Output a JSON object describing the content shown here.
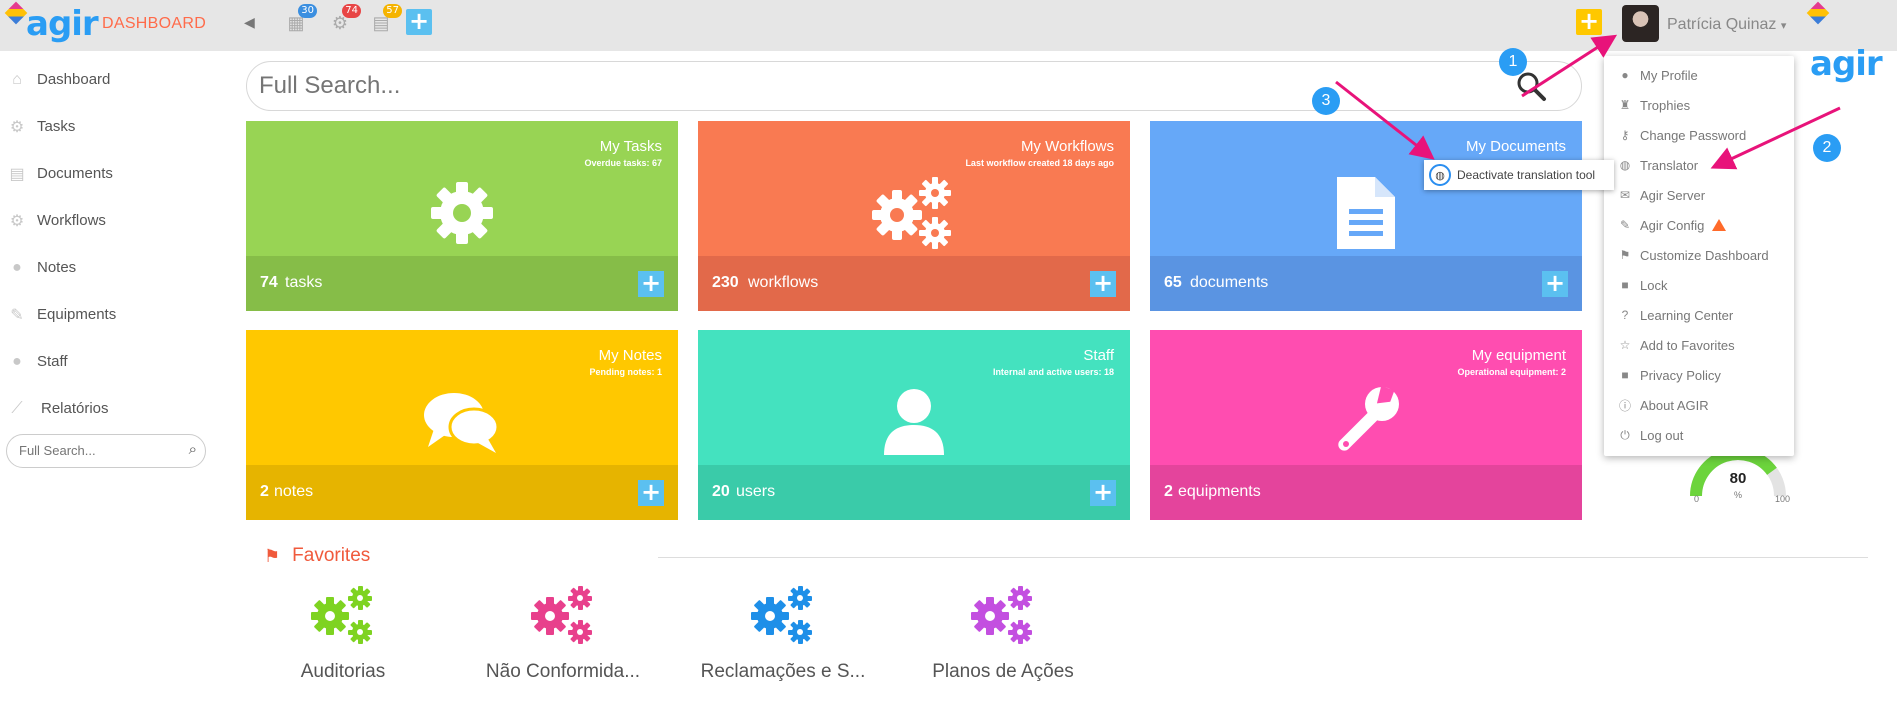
{
  "header": {
    "brand": "agir",
    "section": "DASHBOARD",
    "badges": {
      "calendar": "30",
      "workflows": "74",
      "documents": "57"
    },
    "user_name": "Patrícia Quinaz",
    "colors": {
      "section": "#ff6b4a",
      "badge_blue": "#3b8fe0",
      "badge_red": "#e84545",
      "badge_yellow": "#f5b400"
    }
  },
  "sidebar": {
    "items": [
      {
        "label": "Dashboard",
        "icon": "home-icon"
      },
      {
        "label": "Tasks",
        "icon": "gear-icon"
      },
      {
        "label": "Documents",
        "icon": "document-icon"
      },
      {
        "label": "Workflows",
        "icon": "gears-icon"
      },
      {
        "label": "Notes",
        "icon": "comments-icon"
      },
      {
        "label": "Equipments",
        "icon": "wrench-icon"
      },
      {
        "label": "Staff",
        "icon": "user-icon"
      },
      {
        "label": "Relatórios",
        "icon": "chart-line-icon"
      }
    ],
    "search_placeholder": "Full Search..."
  },
  "main": {
    "search_placeholder": "Full Search...",
    "tiles": [
      {
        "title": "My Tasks",
        "subtitle": "Overdue tasks: 67",
        "count": "74",
        "unit": "tasks",
        "color": "#98d454",
        "foot_color": "#86bd48",
        "icon": "gear-icon"
      },
      {
        "title": "My Workflows",
        "subtitle": "Last workflow created 18 days ago",
        "count": "230",
        "unit": "workflows",
        "color": "#f97a52",
        "foot_color": "#e2694a",
        "icon": "gears-icon"
      },
      {
        "title": "My Documents",
        "subtitle": "",
        "count": "65",
        "unit": "documents",
        "color": "#66a8f8",
        "foot_color": "#5a94e2",
        "icon": "document-icon"
      },
      {
        "title": "My Notes",
        "subtitle": "Pending notes: 1",
        "count": "2",
        "unit": "notes",
        "color": "#ffc800",
        "foot_color": "#e6b400",
        "icon": "comments-icon"
      },
      {
        "title": "Staff",
        "subtitle": "Internal and active users: 18",
        "count": "20",
        "unit": "users",
        "color": "#44e2bf",
        "foot_color": "#3acba9",
        "icon": "user-icon"
      },
      {
        "title": "My equipment",
        "subtitle": "Operational equipment: 2",
        "count": "2",
        "unit": "equipments",
        "color": "#ff4db0",
        "foot_color": "#e4449c",
        "icon": "wrench-icon"
      }
    ]
  },
  "user_menu": {
    "items": [
      {
        "label": "My Profile",
        "icon": "user-icon"
      },
      {
        "label": "Trophies",
        "icon": "trophy-icon"
      },
      {
        "label": "Change Password",
        "icon": "key-icon"
      },
      {
        "label": "Translator",
        "icon": "globe-icon"
      },
      {
        "label": "Agir Server",
        "icon": "envelope-icon"
      },
      {
        "label": "Agir Config",
        "icon": "wrench-icon",
        "warning": true
      },
      {
        "label": "Customize Dashboard",
        "icon": "flag-icon"
      },
      {
        "label": "Lock",
        "icon": "lock-icon"
      },
      {
        "label": "Learning Center",
        "icon": "question-icon"
      },
      {
        "label": "Add to Favorites",
        "icon": "star-icon"
      },
      {
        "label": "Privacy Policy",
        "icon": "lock-icon"
      },
      {
        "label": "About AGIR",
        "icon": "info-icon"
      },
      {
        "label": "Log out",
        "icon": "power-icon"
      }
    ]
  },
  "translator_tooltip": "Deactivate translation tool",
  "annotations": {
    "m1": "1",
    "m2": "2",
    "m3": "3",
    "color": "#e8137a"
  },
  "gauge": {
    "value": "80",
    "unit": "%",
    "min": "0",
    "max": "100",
    "fraction": 0.8,
    "color": "#6cd43c"
  },
  "favorites": {
    "title": "Favorites",
    "items": [
      {
        "label": "Auditorias",
        "color": "#7ed321"
      },
      {
        "label": "Não Conformida...",
        "color": "#e8408c"
      },
      {
        "label": "Reclamações e S...",
        "color": "#1e8fe8"
      },
      {
        "label": "Planos de Ações",
        "color": "#c34fe0"
      }
    ]
  }
}
